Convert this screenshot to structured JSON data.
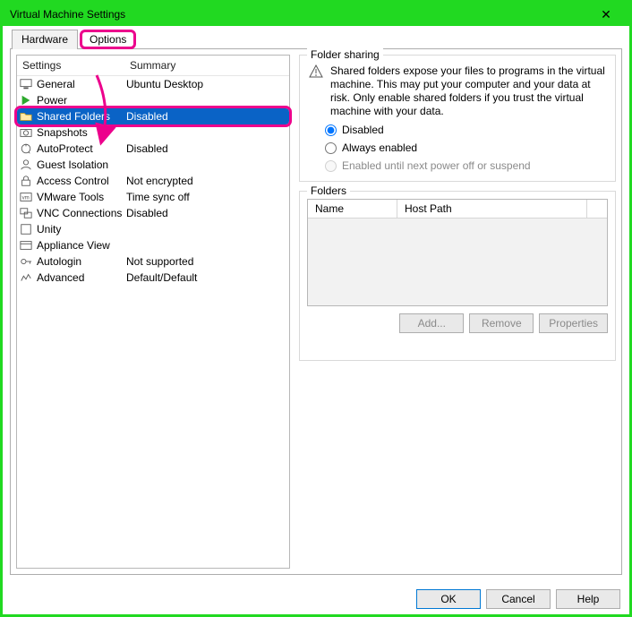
{
  "window": {
    "title": "Virtual Machine Settings"
  },
  "tabs": {
    "hardware": "Hardware",
    "options": "Options"
  },
  "list": {
    "headers": {
      "settings": "Settings",
      "summary": "Summary"
    },
    "items": [
      {
        "icon": "monitor",
        "label": "General",
        "summary": "Ubuntu Desktop"
      },
      {
        "icon": "play",
        "label": "Power",
        "summary": ""
      },
      {
        "icon": "folder",
        "label": "Shared Folders",
        "summary": "Disabled",
        "selected": true
      },
      {
        "icon": "camera",
        "label": "Snapshots",
        "summary": ""
      },
      {
        "icon": "shield-cycle",
        "label": "AutoProtect",
        "summary": "Disabled"
      },
      {
        "icon": "person",
        "label": "Guest Isolation",
        "summary": ""
      },
      {
        "icon": "lock",
        "label": "Access Control",
        "summary": "Not encrypted"
      },
      {
        "icon": "vm-tools",
        "label": "VMware Tools",
        "summary": "Time sync off"
      },
      {
        "icon": "remote",
        "label": "VNC Connections",
        "summary": "Disabled"
      },
      {
        "icon": "box",
        "label": "Unity",
        "summary": ""
      },
      {
        "icon": "appliance",
        "label": "Appliance View",
        "summary": ""
      },
      {
        "icon": "key",
        "label": "Autologin",
        "summary": "Not supported"
      },
      {
        "icon": "advanced",
        "label": "Advanced",
        "summary": "Default/Default"
      }
    ]
  },
  "folder_sharing": {
    "legend": "Folder sharing",
    "warning": "Shared folders expose your files to programs in the virtual machine. This may put your computer and your data at risk. Only enable shared folders if you trust the virtual machine with your data.",
    "options": {
      "disabled": "Disabled",
      "always": "Always enabled",
      "until_off": "Enabled until next power off or suspend"
    },
    "selected": "disabled"
  },
  "folders": {
    "legend": "Folders",
    "headers": {
      "name": "Name",
      "host_path": "Host Path"
    },
    "rows": [],
    "buttons": {
      "add": "Add...",
      "remove": "Remove",
      "properties": "Properties"
    }
  },
  "footer": {
    "ok": "OK",
    "cancel": "Cancel",
    "help": "Help"
  },
  "colors": {
    "accent_green": "#21d921",
    "highlight_pink": "#ec008c",
    "selection_blue": "#0a63c6"
  }
}
